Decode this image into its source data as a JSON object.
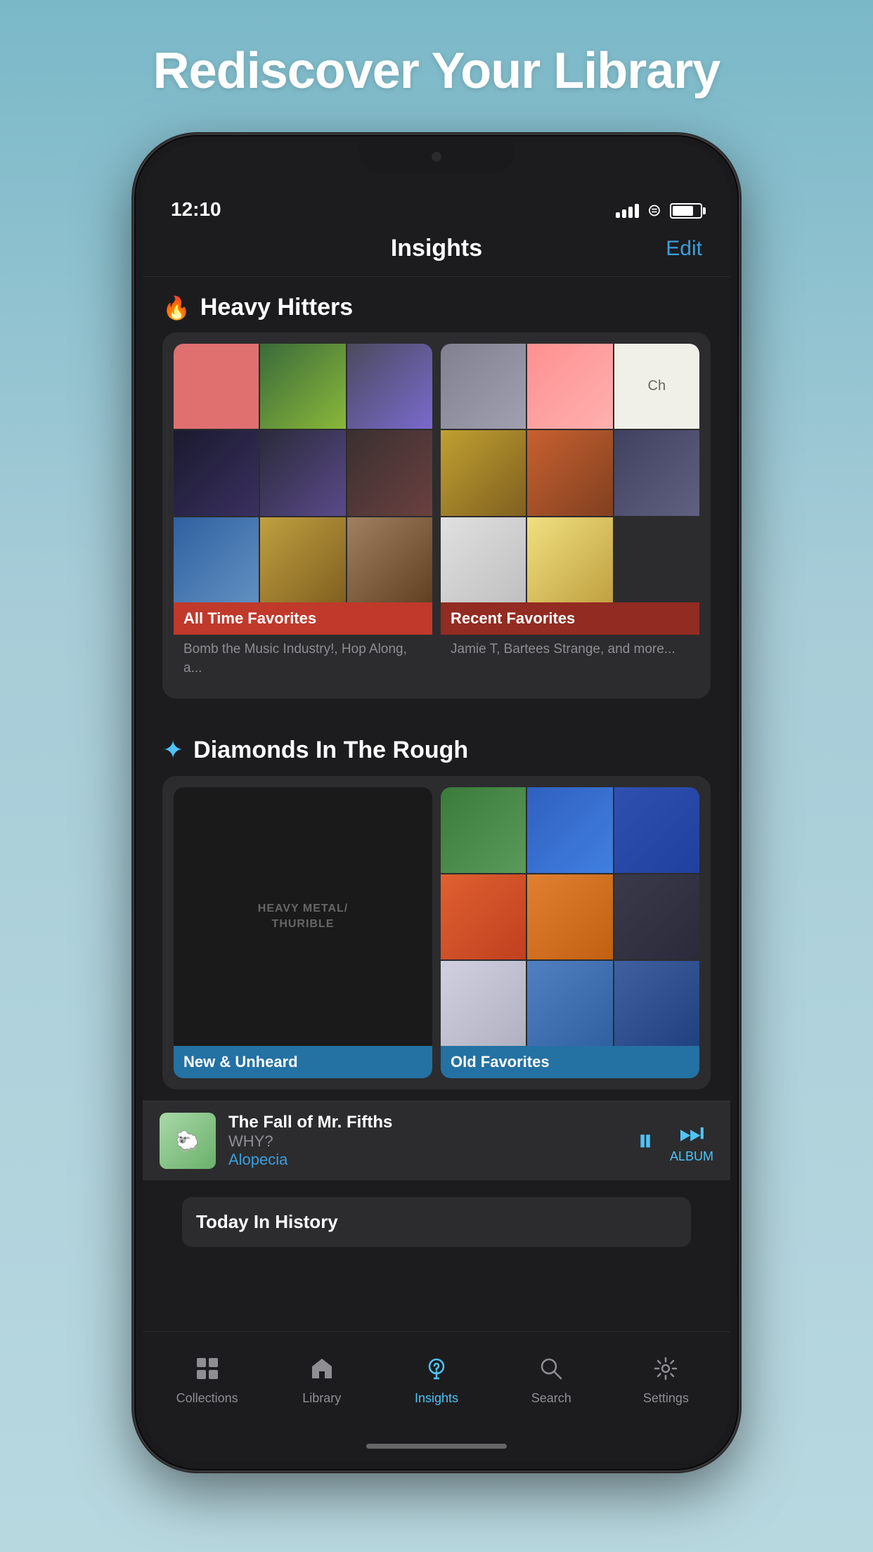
{
  "page": {
    "headline": "Rediscover Your Library",
    "background_gradient_start": "#7ab8c8",
    "background_gradient_end": "#b8d8e0"
  },
  "status_bar": {
    "time": "12:10",
    "signal_bars": 4,
    "wifi": true,
    "battery_pct": 75
  },
  "nav_header": {
    "title": "Insights",
    "edit_label": "Edit"
  },
  "sections": {
    "heavy_hitters": {
      "icon": "🔥",
      "title": "Heavy Hitters",
      "cards": [
        {
          "label": "All Time Favorites",
          "label_color": "red",
          "description": "Bomb the Music Industry!, Hop Along, a..."
        },
        {
          "label": "Recent Favorites",
          "label_color": "darkred",
          "description": "Jamie T, Bartees Strange, and more..."
        }
      ]
    },
    "diamonds": {
      "icon": "✦",
      "title": "Diamonds In The Rough",
      "cards": [
        {
          "label": "New & Unheard",
          "label_color": "blue",
          "art_text_line1": "HEAVY METAL/",
          "art_text_line2": "THURIBLE",
          "description": ""
        },
        {
          "label": "Old Favorites",
          "label_color": "blue",
          "description": ""
        }
      ]
    },
    "today_history": {
      "title": "Today In History"
    }
  },
  "now_playing": {
    "song": "The Fall of Mr. Fifths",
    "artist": "WHY?",
    "album": "Alopecia",
    "pause_label": "",
    "album_label": "ALBUM"
  },
  "tab_bar": {
    "items": [
      {
        "id": "collections",
        "label": "Collections",
        "icon": "grid",
        "active": false
      },
      {
        "id": "library",
        "label": "Library",
        "icon": "house",
        "active": false
      },
      {
        "id": "insights",
        "label": "Insights",
        "icon": "lightbulb",
        "active": true
      },
      {
        "id": "search",
        "label": "Search",
        "icon": "magnify",
        "active": false
      },
      {
        "id": "settings",
        "label": "Settings",
        "icon": "gear",
        "active": false
      }
    ]
  }
}
